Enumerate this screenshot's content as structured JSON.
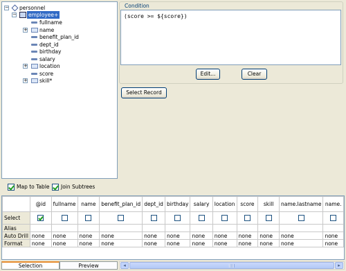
{
  "tree": {
    "root": {
      "label": "personnel"
    },
    "selected": {
      "label": "employee+"
    },
    "children": [
      {
        "label": "fullname",
        "kind": "attribute"
      },
      {
        "label": "name",
        "kind": "element"
      },
      {
        "label": "benefit_plan_id",
        "kind": "attribute"
      },
      {
        "label": "dept_id",
        "kind": "attribute"
      },
      {
        "label": "birthday",
        "kind": "attribute"
      },
      {
        "label": "salary",
        "kind": "attribute"
      },
      {
        "label": "location",
        "kind": "element"
      },
      {
        "label": "score",
        "kind": "attribute"
      },
      {
        "label": "skill*",
        "kind": "element"
      }
    ]
  },
  "condition": {
    "title": "Condition",
    "text": "(score >= ${score})",
    "edit_label": "Edit...",
    "clear_label": "Clear"
  },
  "select_record_label": "Select Record",
  "options": {
    "map_to_table": {
      "label": "Map to Table",
      "checked": true
    },
    "join_subtrees": {
      "label": "Join Subtrees",
      "checked": true
    }
  },
  "grid": {
    "columns": [
      "@id",
      "fullname",
      "name",
      "benefit_plan_id",
      "dept_id",
      "birthday",
      "salary",
      "location",
      "score",
      "skill",
      "name.lastname",
      "name."
    ],
    "row_labels": [
      "Select",
      "Alias",
      "Auto Drill",
      "Format"
    ],
    "select": [
      true,
      false,
      false,
      false,
      false,
      false,
      false,
      false,
      false,
      false,
      false,
      false
    ],
    "alias": [
      "",
      "",
      "",
      "",
      "",
      "",
      "",
      "",
      "",
      "",
      "",
      ""
    ],
    "auto_drill": [
      "none",
      "none",
      "none",
      "none",
      "none",
      "none",
      "none",
      "none",
      "none",
      "none",
      "none",
      "none"
    ],
    "format": [
      "none",
      "none",
      "none",
      "none",
      "none",
      "none",
      "none",
      "none",
      "none",
      "none",
      "none",
      "none"
    ]
  },
  "tabs": [
    {
      "label": "Selection",
      "active": true
    },
    {
      "label": "Preview",
      "active": false
    }
  ],
  "colors": {
    "selection": "#316ac5",
    "window_bg": "#ece9d8",
    "border": "#7f9db9"
  }
}
